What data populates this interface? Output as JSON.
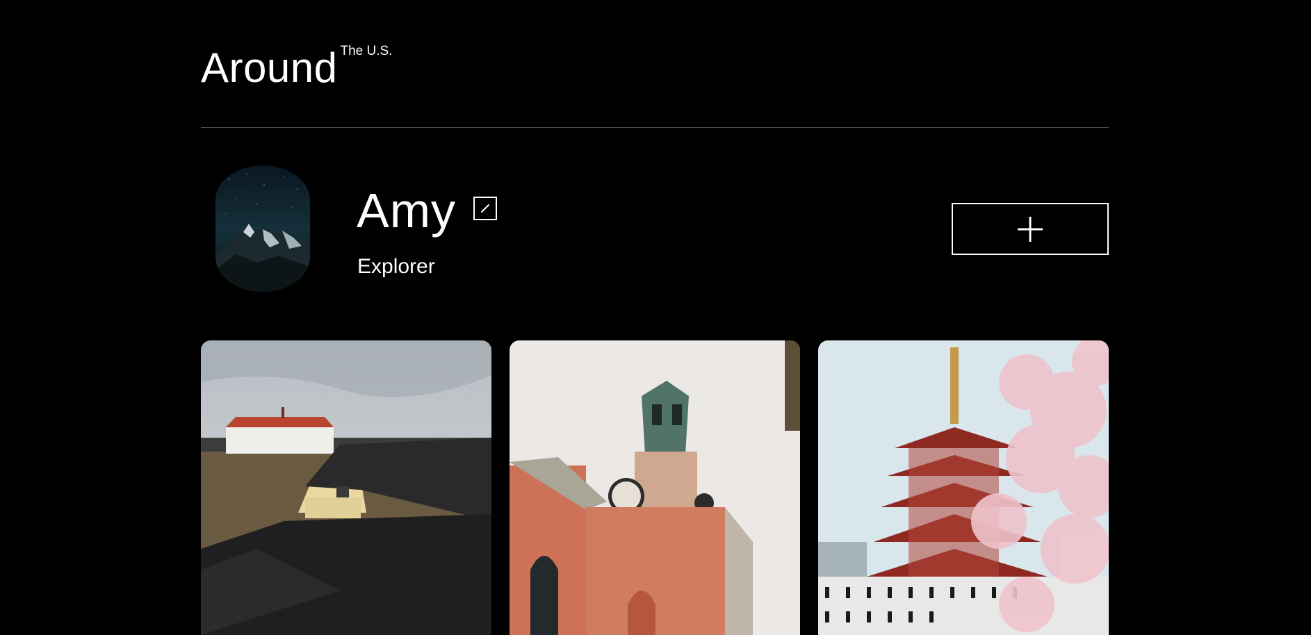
{
  "header": {
    "logo_main": "Around",
    "logo_sup": "The U.S."
  },
  "profile": {
    "name": "Amy",
    "role": "Explorer",
    "avatar_icon": "mountain-night-sky-photo",
    "edit_icon": "pencil-icon"
  },
  "actions": {
    "add_icon": "plus-icon"
  },
  "cards": [
    {
      "image": "farm-houses-photo"
    },
    {
      "image": "church-clock-tower-photo"
    },
    {
      "image": "pagoda-cherry-blossom-photo"
    }
  ],
  "colors": {
    "background": "#000000",
    "text": "#ffffff",
    "divider": "#4a4a4a"
  }
}
